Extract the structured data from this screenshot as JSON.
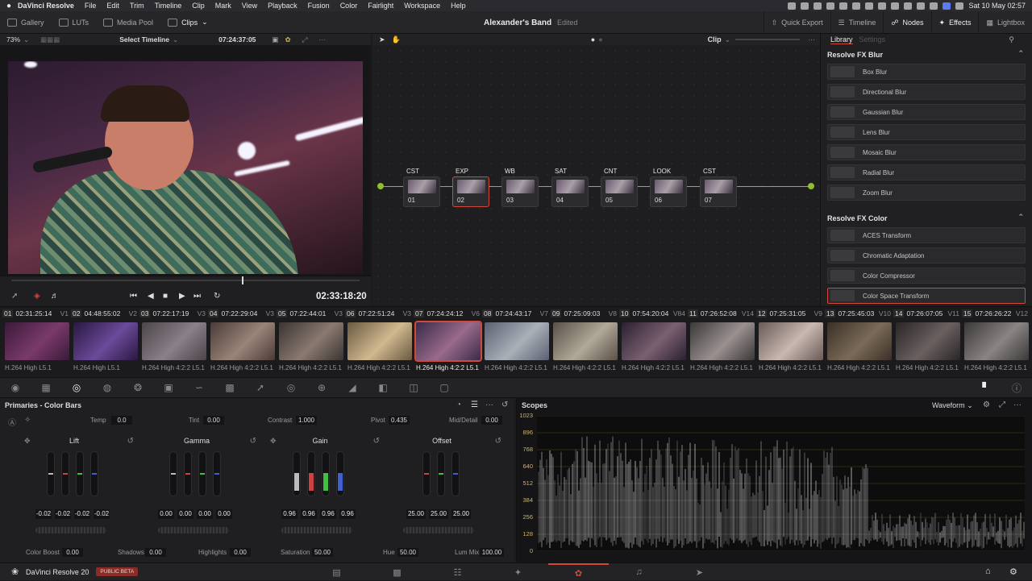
{
  "mac_menu": {
    "app": "DaVinci Resolve",
    "items": [
      "File",
      "Edit",
      "Trim",
      "Timeline",
      "Clip",
      "Mark",
      "View",
      "Playback",
      "Fusion",
      "Color",
      "Fairlight",
      "Workspace",
      "Help"
    ],
    "datetime": "Sat 10 May  02:57"
  },
  "toolbar": {
    "gallery": "Gallery",
    "luts": "LUTs",
    "media_pool": "Media Pool",
    "clips": "Clips",
    "project_name": "Alexander's Band",
    "project_status": "Edited",
    "quick_export": "Quick Export",
    "timeline": "Timeline",
    "nodes": "Nodes",
    "effects": "Effects",
    "lightbox": "Lightbox"
  },
  "viewer": {
    "zoom": "73%",
    "timeline_select": "Select Timeline",
    "timecode_top": "07:24:37:05",
    "timecode": "02:33:18:20"
  },
  "node_editor": {
    "mode": "Clip",
    "nodes": [
      {
        "label": "CST",
        "num": "01"
      },
      {
        "label": "EXP",
        "num": "02"
      },
      {
        "label": "WB",
        "num": "03"
      },
      {
        "label": "SAT",
        "num": "04"
      },
      {
        "label": "CNT",
        "num": "05"
      },
      {
        "label": "LOOK",
        "num": "06"
      },
      {
        "label": "CST",
        "num": "07"
      }
    ]
  },
  "library": {
    "tab_library": "Library",
    "tab_settings": "Settings",
    "section_blur": "Resolve FX Blur",
    "blur_items": [
      "Box Blur",
      "Directional Blur",
      "Gaussian Blur",
      "Lens Blur",
      "Mosaic Blur",
      "Radial Blur",
      "Zoom Blur"
    ],
    "section_color": "Resolve FX Color",
    "color_items": [
      "ACES Transform",
      "Chromatic Adaptation",
      "Color Compressor",
      "Color Space Transform"
    ]
  },
  "clips": [
    {
      "n": "01",
      "tc": "02:31:25:14",
      "v": "V1",
      "codec": "H.264 High L5.1",
      "c1": "#3a1a3a",
      "c2": "#7a3a6a"
    },
    {
      "n": "02",
      "tc": "04:48:55:02",
      "v": "V2",
      "codec": "H.264 High L5.1",
      "c1": "#2a1840",
      "c2": "#6a4a9a"
    },
    {
      "n": "03",
      "tc": "07:22:17:19",
      "v": "V3",
      "codec": "H.264 High 4:2:2 L5.1",
      "c1": "#4a4448",
      "c2": "#8a8088"
    },
    {
      "n": "04",
      "tc": "07:22:29:04",
      "v": "V3",
      "codec": "H.264 High 4:2:2 L5.1",
      "c1": "#4a3a38",
      "c2": "#9a8478"
    },
    {
      "n": "05",
      "tc": "07:22:44:01",
      "v": "V3",
      "codec": "H.264 High 4:2:2 L5.1",
      "c1": "#3a3432",
      "c2": "#8a7a70"
    },
    {
      "n": "06",
      "tc": "07:22:51:24",
      "v": "V3",
      "codec": "H.264 High 4:2:2 L5.1",
      "c1": "#6a5a40",
      "c2": "#d0b890"
    },
    {
      "n": "07",
      "tc": "07:24:24:12",
      "v": "V6",
      "codec": "H.264 High 4:2:2 L5.1",
      "c1": "#3a2a4a",
      "c2": "#9a6a8a"
    },
    {
      "n": "08",
      "tc": "07:24:43:17",
      "v": "V7",
      "codec": "H.264 High 4:2:2 L5.1",
      "c1": "#5a6070",
      "c2": "#aab0b8"
    },
    {
      "n": "09",
      "tc": "07:25:09:03",
      "v": "V8",
      "codec": "H.264 High 4:2:2 L5.1",
      "c1": "#5a5048",
      "c2": "#b0a898"
    },
    {
      "n": "10",
      "tc": "07:54:20:04",
      "v": "V84",
      "codec": "H.264 High 4:2:2 L5.1",
      "c1": "#2a2030",
      "c2": "#7a6070"
    },
    {
      "n": "11",
      "tc": "07:26:52:08",
      "v": "V14",
      "codec": "H.264 High 4:2:2 L5.1",
      "c1": "#3a3838",
      "c2": "#9a9090"
    },
    {
      "n": "12",
      "tc": "07:25:31:05",
      "v": "V9",
      "codec": "H.264 High 4:2:2 L5.1",
      "c1": "#6a5a58",
      "c2": "#c8b8b0"
    },
    {
      "n": "13",
      "tc": "07:25:45:03",
      "v": "V10",
      "codec": "H.264 High 4:2:2 L5.1",
      "c1": "#3a3028",
      "c2": "#7a6a58"
    },
    {
      "n": "14",
      "tc": "07:26:07:05",
      "v": "V11",
      "codec": "H.264 High 4:2:2 L5.1",
      "c1": "#2a2626",
      "c2": "#6a6060"
    },
    {
      "n": "15",
      "tc": "07:26:26:22",
      "v": "V12",
      "codec": "H.264 High 4:2:2 L5.1",
      "c1": "#3a3838",
      "c2": "#8a8484"
    }
  ],
  "primaries": {
    "title": "Primaries - Color Bars",
    "temp_label": "Temp",
    "temp": "0.0",
    "tint_label": "Tint",
    "tint": "0.00",
    "contrast_label": "Contrast",
    "contrast": "1.000",
    "pivot_label": "Pivot",
    "pivot": "0.435",
    "middetail_label": "Mid/Detail",
    "middetail": "0.00",
    "lift_label": "Lift",
    "lift": [
      "-0.02",
      "-0.02",
      "-0.02",
      "-0.02"
    ],
    "gamma_label": "Gamma",
    "gamma": [
      "0.00",
      "0.00",
      "0.00",
      "0.00"
    ],
    "gain_label": "Gain",
    "gain": [
      "0.96",
      "0.96",
      "0.96",
      "0.96"
    ],
    "offset_label": "Offset",
    "offset": [
      "25.00",
      "25.00",
      "25.00"
    ],
    "colorboost_label": "Color Boost",
    "colorboost": "0.00",
    "shadows_label": "Shadows",
    "shadows": "0.00",
    "highlights_label": "Highlights",
    "highlights": "0.00",
    "saturation_label": "Saturation",
    "saturation": "50.00",
    "hue_label": "Hue",
    "hue": "50.00",
    "lummix_label": "Lum Mix",
    "lummix": "100.00"
  },
  "scopes": {
    "title": "Scopes",
    "mode": "Waveform",
    "scale": [
      "1023",
      "896",
      "768",
      "640",
      "512",
      "384",
      "256",
      "128",
      "0"
    ]
  },
  "status": {
    "app_version": "DaVinci Resolve 20",
    "badge": "PUBLIC BETA"
  },
  "colors": {
    "accent": "#d04a3a",
    "scope_trace": "#e8e8e8",
    "scope_grid": "#d5b35a"
  }
}
